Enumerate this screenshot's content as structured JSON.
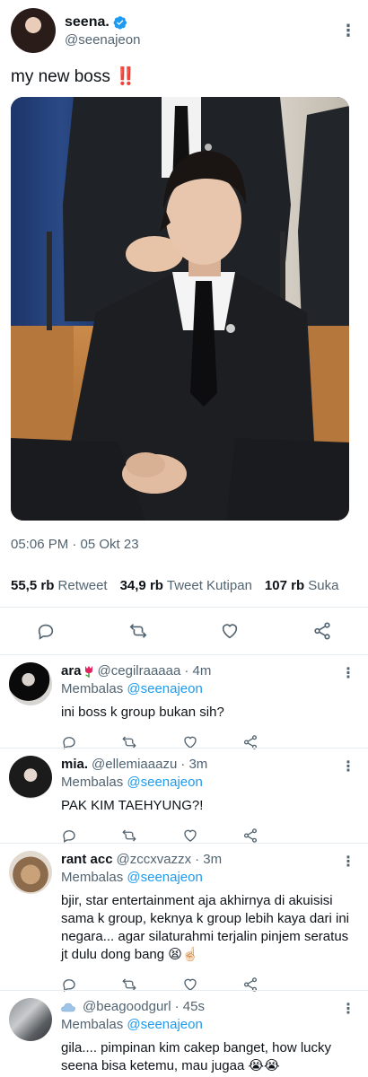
{
  "tweet": {
    "author": {
      "display_name": "seena.",
      "handle": "@seenajeon",
      "verified": true
    },
    "text": "my new boss",
    "emoji": "‼️",
    "timestamp": "05:06 PM · 05 Okt 23",
    "stats": {
      "retweets_value": "55,5 rb",
      "retweets_label": "Retweet",
      "quotes_value": "34,9 rb",
      "quotes_label": "Tweet Kutipan",
      "likes_value": "107 rb",
      "likes_label": "Suka"
    },
    "actions": [
      "reply-icon",
      "retweet-icon",
      "like-icon",
      "share-icon"
    ]
  },
  "replies": [
    {
      "name": "ara",
      "name_emoji": "tulip",
      "handle": "@cegilraaaaa",
      "time": "· 4m",
      "replying_label": "Membalas",
      "replying_to": "@seenajeon",
      "text": "ini boss k group bukan sih?"
    },
    {
      "name": "mia.",
      "handle": "@ellemiaaazu",
      "time": "· 3m",
      "replying_label": "Membalas",
      "replying_to": "@seenajeon",
      "text": "PAK KIM TAEHYUNG?!"
    },
    {
      "name": "rant acc",
      "handle": "@zccxvazzx",
      "time": "· 3m",
      "replying_label": "Membalas",
      "replying_to": "@seenajeon",
      "text": "bjir, star entertainment aja akhirnya di akuisisi sama k group, keknya k group lebih kaya dari ini negara... agar silaturahmi terjalin pinjem seratus jt dulu dong bang",
      "trailing_emoji": "😫☝🏻"
    },
    {
      "name": "",
      "name_emoji": "cloud",
      "handle": "@beagoodgurl",
      "time": "· 45s",
      "replying_label": "Membalas",
      "replying_to": "@seenajeon",
      "text": "gila.... pimpinan kim cakep banget, how lucky seena bisa ketemu, mau jugaa",
      "trailing_emoji": "😭😭"
    }
  ],
  "colors": {
    "accent": "#1d9bf0",
    "text": "#0f1419",
    "secondary": "#536471",
    "divider": "#e6ecf0"
  }
}
